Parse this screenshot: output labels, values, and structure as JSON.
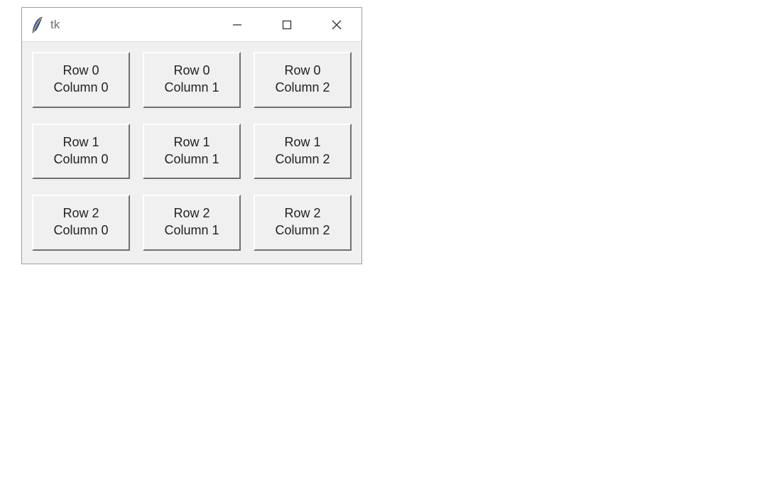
{
  "window": {
    "title": "tk"
  },
  "grid": {
    "rows": 3,
    "cols": 3,
    "cells": [
      [
        "Row 0\nColumn 0",
        "Row 0\nColumn 1",
        "Row 0\nColumn 2"
      ],
      [
        "Row 1\nColumn 0",
        "Row 1\nColumn 1",
        "Row 1\nColumn 2"
      ],
      [
        "Row 2\nColumn 0",
        "Row 2\nColumn 1",
        "Row 2\nColumn 2"
      ]
    ]
  }
}
